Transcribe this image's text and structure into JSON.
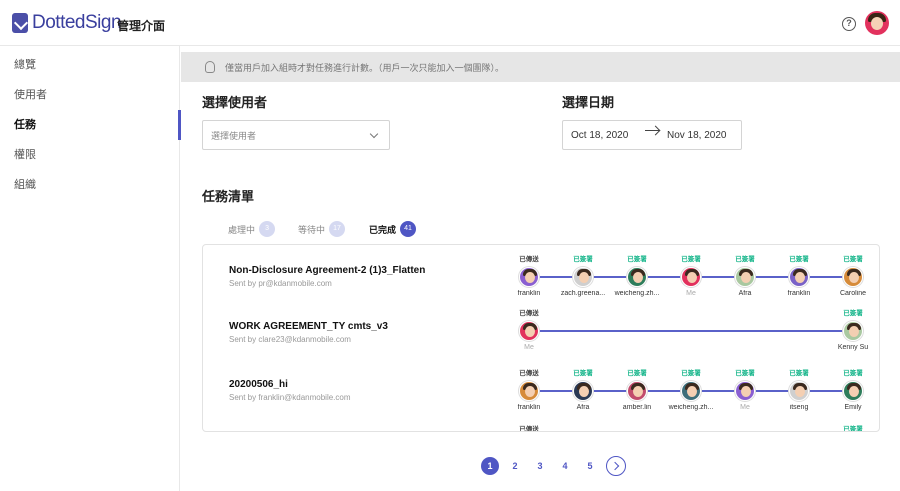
{
  "app": {
    "logo_text": "DottedSign",
    "title": "管理介面"
  },
  "header": {
    "help_icon": "question-circle-icon",
    "help_glyph": "?"
  },
  "sidebar": {
    "items": [
      {
        "label": "總覽",
        "active": false
      },
      {
        "label": "使用者",
        "active": false
      },
      {
        "label": "任務",
        "active": true
      },
      {
        "label": "權限",
        "active": false
      },
      {
        "label": "組織",
        "active": false
      }
    ]
  },
  "notice": {
    "icon": "lightbulb-icon",
    "text": "僅當用戶加入組時才對任務進行計數。（用戶一次只能加入一個團隊）。"
  },
  "user_select": {
    "heading": "選擇使用者",
    "placeholder": "選擇使用者"
  },
  "date_select": {
    "heading": "選擇日期",
    "start": "Oct 18, 2020",
    "end": "Nov 18, 2020"
  },
  "task_list": {
    "heading": "任務清單",
    "tabs": [
      {
        "label": "處理中",
        "count": "3",
        "active": false
      },
      {
        "label": "等待中",
        "count": "17",
        "active": false
      },
      {
        "label": "已完成",
        "count": "41",
        "active": true
      }
    ],
    "tasks": [
      {
        "title": "Non-Disclosure Agreement-2 (1)3_Flatten",
        "sent_by": "Sent by pr@kdanmobile.com",
        "steps": [
          {
            "status": "已傳送",
            "name": "franklin"
          },
          {
            "status": "已簽署",
            "name": "zach.greena..."
          },
          {
            "status": "已簽署",
            "name": "weicheng.zh..."
          },
          {
            "status": "已簽署",
            "name": "Me"
          },
          {
            "status": "已簽署",
            "name": "Afra"
          },
          {
            "status": "已簽署",
            "name": "franklin"
          },
          {
            "status": "已簽署",
            "name": "Caroline"
          }
        ]
      },
      {
        "title": "WORK AGREEMENT_TY cmts_v3",
        "sent_by": "Sent by clare23@kdanmobile.com",
        "steps": [
          {
            "status": "已傳送",
            "name": "Me"
          },
          {
            "status": "已簽署",
            "name": "Kenny Su"
          }
        ]
      },
      {
        "title": "20200506_hi",
        "sent_by": "Sent by franklin@kdanmobile.com",
        "steps": [
          {
            "status": "已傳送",
            "name": "franklin"
          },
          {
            "status": "已簽署",
            "name": "Afra"
          },
          {
            "status": "已簽署",
            "name": "amber.lin"
          },
          {
            "status": "已簽署",
            "name": "weicheng.zh..."
          },
          {
            "status": "已簽署",
            "name": "Me"
          },
          {
            "status": "已簽署",
            "name": "itseng"
          },
          {
            "status": "已簽署",
            "name": "Emily"
          }
        ]
      },
      {
        "title": "",
        "sent_by": "",
        "steps": [
          {
            "status": "已傳送",
            "name": ""
          },
          {
            "status": "已簽署",
            "name": ""
          }
        ]
      }
    ]
  },
  "pagination": {
    "pages": [
      "1",
      "2",
      "3",
      "4",
      "5"
    ],
    "current": "1"
  },
  "colors": {
    "accent": "#4f56c4",
    "signed": "#15b58a",
    "notice_bg": "#e6e6e6"
  }
}
